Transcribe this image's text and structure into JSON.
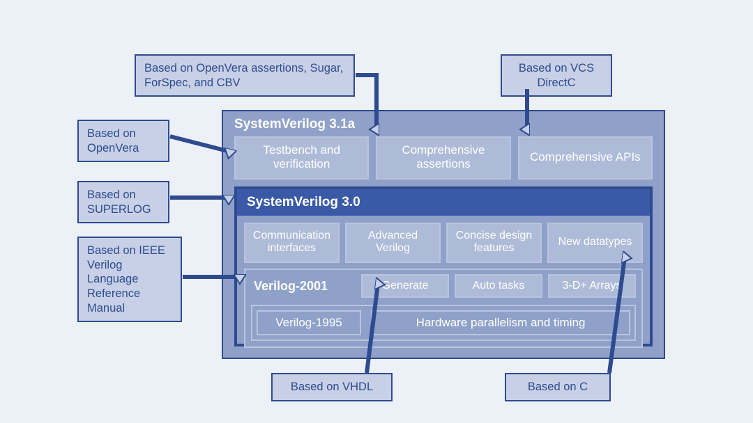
{
  "callouts": {
    "top_left": "Based on OpenVera assertions, Sugar, ForSpec, and CBV",
    "top_right": "Based on VCS DirectC",
    "openvera": "Based on OpenVera",
    "superlog": "Based on SUPERLOG",
    "ieee": "Based on IEEE Verilog Language Reference Manual",
    "vhdl": "Based on VHDL",
    "c": "Based on C"
  },
  "sv31a": {
    "title": "SystemVerilog 3.1a",
    "cells": [
      "Testbench and verification",
      "Comprehensive assertions",
      "Comprehensive APIs"
    ]
  },
  "sv30": {
    "title": "SystemVerilog 3.0",
    "cells": [
      "Communication interfaces",
      "Advanced Verilog",
      "Concise design features",
      "New datatypes"
    ]
  },
  "v2001": {
    "title": "Verilog-2001",
    "cells": [
      "Generate",
      "Auto tasks",
      "3-D+ Arrays"
    ]
  },
  "v1995": {
    "title": "Verilog-1995",
    "desc": "Hardware parallelism and timing"
  }
}
